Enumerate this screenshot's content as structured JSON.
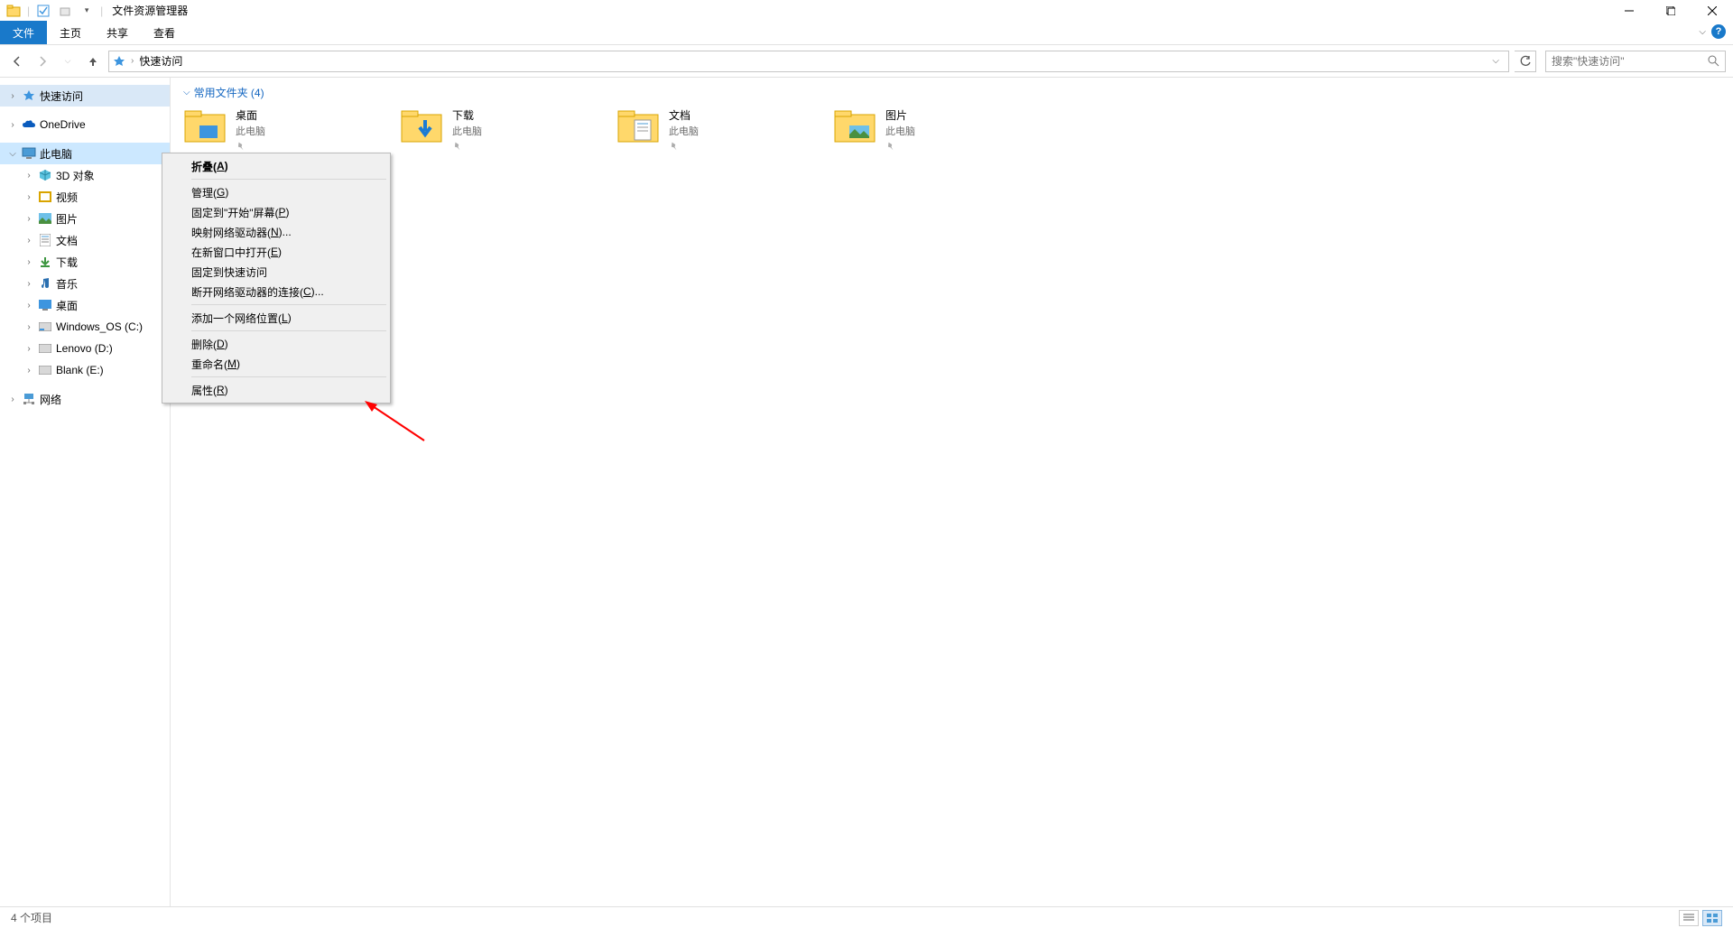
{
  "title": "文件资源管理器",
  "ribbon": {
    "file": "文件",
    "home": "主页",
    "share": "共享",
    "view": "查看"
  },
  "breadcrumb": {
    "location": "快速访问"
  },
  "search": {
    "placeholder": "搜索\"快速访问\""
  },
  "tree": {
    "quick_access": "快速访问",
    "onedrive": "OneDrive",
    "this_pc": "此电脑",
    "objects3d": "3D 对象",
    "videos": "视频",
    "pictures": "图片",
    "documents": "文档",
    "downloads": "下载",
    "music": "音乐",
    "desktop": "桌面",
    "drive_c": "Windows_OS (C:)",
    "drive_d": "Lenovo (D:)",
    "drive_e": "Blank (E:)",
    "network": "网络"
  },
  "group": {
    "header": "常用文件夹 (4)"
  },
  "folders": [
    {
      "name": "桌面",
      "loc": "此电脑"
    },
    {
      "name": "下载",
      "loc": "此电脑"
    },
    {
      "name": "文档",
      "loc": "此电脑"
    },
    {
      "name": "图片",
      "loc": "此电脑"
    }
  ],
  "context_menu": {
    "collapse": "折叠(<u>A</u>)",
    "manage": "管理(<u>G</u>)",
    "pin_start": "固定到\"开始\"屏幕(<u>P</u>)",
    "map_network": "映射网络驱动器(<u>N</u>)...",
    "open_new_window": "在新窗口中打开(<u>E</u>)",
    "pin_quick": "固定到快速访问",
    "disconnect_network": "断开网络驱动器的连接(<u>C</u>)...",
    "add_network_location": "添加一个网络位置(<u>L</u>)",
    "delete": "删除(<u>D</u>)",
    "rename": "重命名(<u>M</u>)",
    "properties": "属性(<u>R</u>)"
  },
  "status": {
    "item_count": "4 个项目"
  }
}
